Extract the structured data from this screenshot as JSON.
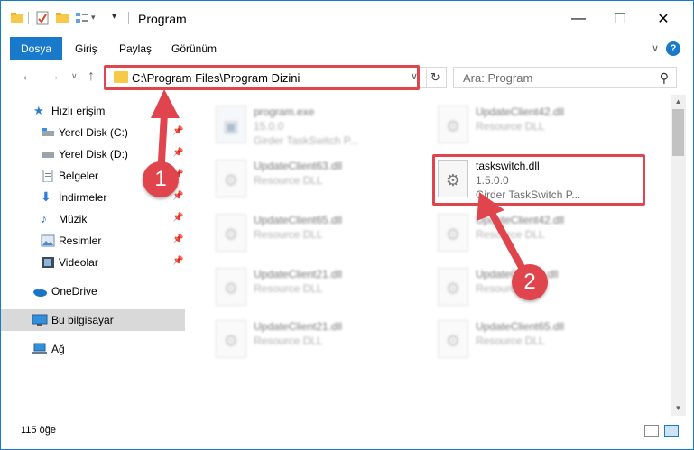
{
  "window": {
    "title": "Program"
  },
  "ribbon": {
    "tabs": [
      "Dosya",
      "Giriş",
      "Paylaş",
      "Görünüm"
    ],
    "help": "?"
  },
  "nav": {
    "address": "C:\\Program Files\\Program Dizini",
    "search_placeholder": "Ara: Program"
  },
  "sidebar": {
    "items": [
      {
        "label": "Hızlı erişim",
        "icon": "star-icon",
        "pinned": false
      },
      {
        "label": "Yerel Disk (C:)",
        "icon": "drive-icon",
        "pinned": true
      },
      {
        "label": "Yerel Disk (D:)",
        "icon": "drive-icon",
        "pinned": true
      },
      {
        "label": "Belgeler",
        "icon": "documents-icon",
        "pinned": true
      },
      {
        "label": "İndirmeler",
        "icon": "download-icon",
        "pinned": true
      },
      {
        "label": "Müzik",
        "icon": "music-icon",
        "pinned": true
      },
      {
        "label": "Resimler",
        "icon": "pictures-icon",
        "pinned": true
      },
      {
        "label": "Videolar",
        "icon": "videos-icon",
        "pinned": true
      },
      {
        "label": "OneDrive",
        "icon": "cloud-icon",
        "pinned": false
      },
      {
        "label": "Bu bilgisayar",
        "icon": "computer-icon",
        "pinned": false
      },
      {
        "label": "Ağ",
        "icon": "network-icon",
        "pinned": false
      }
    ]
  },
  "files": [
    {
      "name": "program.exe",
      "line2": "15.0.0",
      "line3": "Girder TaskSwitch P...",
      "blurred": true
    },
    {
      "name": "UpdateClient42.dll",
      "line2": "Resource DLL",
      "line3": "",
      "blurred": true
    },
    {
      "name": "UpdateClient63.dll",
      "line2": "Resource DLL",
      "line3": "",
      "blurred": true
    },
    {
      "name": "taskswitch.dll",
      "line2": "1.5.0.0",
      "line3": "Girder TaskSwitch P...",
      "blurred": false
    },
    {
      "name": "UpdateClient65.dll",
      "line2": "Resource DLL",
      "line3": "",
      "blurred": true
    },
    {
      "name": "UpdateClient42.dll",
      "line2": "Resource DLL",
      "line3": "",
      "blurred": true
    },
    {
      "name": "UpdateClient21.dll",
      "line2": "Resource DLL",
      "line3": "",
      "blurred": true
    },
    {
      "name": "UpdateClient5.dll",
      "line2": "Resource DLL",
      "line3": "",
      "blurred": true
    },
    {
      "name": "UpdateClient21.dll",
      "line2": "Resource DLL",
      "line3": "",
      "blurred": true
    },
    {
      "name": "UpdateClient65.dll",
      "line2": "Resource DLL",
      "line3": "",
      "blurred": true
    }
  ],
  "status": {
    "count": "115 öğe"
  },
  "annotations": {
    "badge1": "1",
    "badge2": "2",
    "color": "#e0444c"
  }
}
